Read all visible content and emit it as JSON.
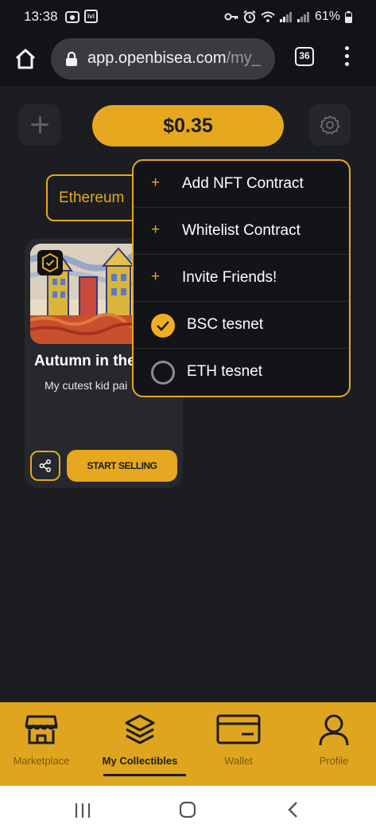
{
  "status_bar": {
    "time": "13:38",
    "ivi_badge": "ivi",
    "battery": "61%"
  },
  "browser": {
    "url_main": "app.openbisea.com",
    "url_rest": "/my_",
    "tab_count": "36"
  },
  "header": {
    "balance": "$0.35"
  },
  "chain_selector": {
    "label": "Ethereum"
  },
  "card": {
    "title": "Autumn in the",
    "description": "My cutest kid pai",
    "sell_label": "START SELLING"
  },
  "dropdown": {
    "items": [
      {
        "icon": "plus-icon",
        "label": "Add NFT Contract"
      },
      {
        "icon": "plus-icon",
        "label": "Whitelist Contract"
      },
      {
        "icon": "plus-icon",
        "label": "Invite Friends!"
      }
    ],
    "networks": [
      {
        "label": "BSC tesnet",
        "selected": true
      },
      {
        "label": "ETH tesnet",
        "selected": false
      }
    ]
  },
  "bottom_nav": {
    "items": [
      {
        "label": "Marketplace",
        "icon": "store-icon"
      },
      {
        "label": "My Collectibles",
        "icon": "layers-icon",
        "active": true
      },
      {
        "label": "Wallet",
        "icon": "wallet-icon"
      },
      {
        "label": "Profile",
        "icon": "user-icon"
      }
    ]
  },
  "colors": {
    "accent": "#e5a81f",
    "background": "#1b1d21",
    "card": "#26282d"
  }
}
